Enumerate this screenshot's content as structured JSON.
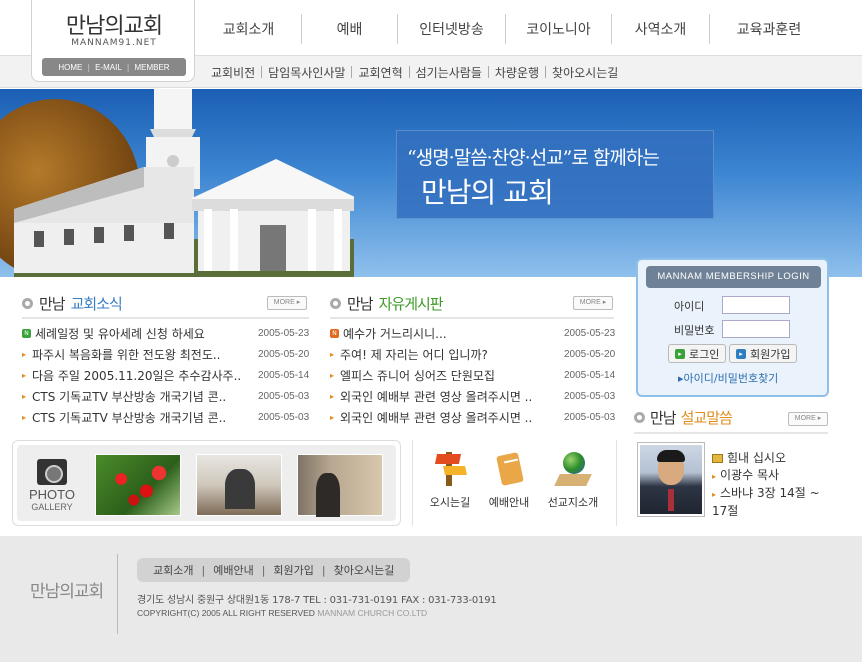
{
  "logo": {
    "title": "만남의교회",
    "url": "MANNAM91.NET",
    "links": [
      "HOME",
      "E-MAIL",
      "MEMBER"
    ]
  },
  "gnb": [
    {
      "label": "교회소개",
      "w": 106
    },
    {
      "label": "예배",
      "w": 96
    },
    {
      "label": "인터넷방송",
      "w": 108
    },
    {
      "label": "코이노니아",
      "w": 106
    },
    {
      "label": "사역소개",
      "w": 98
    },
    {
      "label": "교육과훈련",
      "w": 118
    }
  ],
  "lnb": [
    "교회비전",
    "담임목사인사말",
    "교회연혁",
    "섬기는사람들",
    "차량운행",
    "찾아오시는길"
  ],
  "hero": {
    "slogan_line1": "“생명·말씀·찬양·선교”로 함께하는",
    "slogan_line2": "만남의 교회"
  },
  "login": {
    "title": "MANNAM MEMBERSHIP LOGIN",
    "id_label": "아이디",
    "pw_label": "비밀번호",
    "login_button": "로그인",
    "join_button": "회원가입",
    "find_link": "▸아이디/비밀번호찾기"
  },
  "news": {
    "title_prefix": "만남",
    "title_main": "교회소식",
    "more": "MORE ▸",
    "items": [
      {
        "text": "세례일정 및 유아세례 신청 하세요",
        "date": "2005-05-23"
      },
      {
        "text": "파주시 복음화를 위한 전도왕 최전도..",
        "date": "2005-05-20"
      },
      {
        "text": "다음 주일 2005.11.20일은 추수감사주..",
        "date": "2005-05-14"
      },
      {
        "text": "CTS 기독교TV 부산방송 개국기념 콘..",
        "date": "2005-05-03"
      },
      {
        "text": "CTS 기독교TV 부산방송 개국기념 콘..",
        "date": "2005-05-03"
      }
    ]
  },
  "board": {
    "title_prefix": "만남",
    "title_main": "자유게시판",
    "more": "MORE ▸",
    "items": [
      {
        "text": "예수가 거느리시니...",
        "date": "2005-05-23"
      },
      {
        "text": "주여! 제 자리는 어디 입니까?",
        "date": "2005-05-20"
      },
      {
        "text": "엘피스 쥬니어 싱어즈 단원모집",
        "date": "2005-05-14"
      },
      {
        "text": "외국인 예배부 관련 영상 올려주시면 ..",
        "date": "2005-05-03"
      },
      {
        "text": "외국인 예배부 관련 영상 올려주시면 ..",
        "date": "2005-05-03"
      }
    ]
  },
  "sermon": {
    "title_prefix": "만남",
    "title_main": "설교말씀",
    "more": "MORE ▸",
    "headline": "힘내 십시오",
    "pastor": "이광수 목사",
    "verse": "스바냐 3장 14절 ~ 17절"
  },
  "gallery": {
    "label1": "PHOTO",
    "label2": "GALLERY"
  },
  "quick": [
    {
      "label": "오시는길",
      "icon": "signpost-icon"
    },
    {
      "label": "예배안내",
      "icon": "scroll-icon"
    },
    {
      "label": "선교지소개",
      "icon": "globe-icon"
    }
  ],
  "footer": {
    "logo": "만남의교회",
    "nav": [
      "교회소개",
      "예배안내",
      "회원가입",
      "찾아오시는길"
    ],
    "address": "경기도 성남시 중원구 상대원1동 178-7 TEL : 031-731-0191 FAX : 031-733-0191",
    "copyright_prefix": "COPYRIGHT(C) 2005 ALL RIGHT RESERVED",
    "copyright_suffix": "MANNAM CHURCH CO.LTD"
  }
}
